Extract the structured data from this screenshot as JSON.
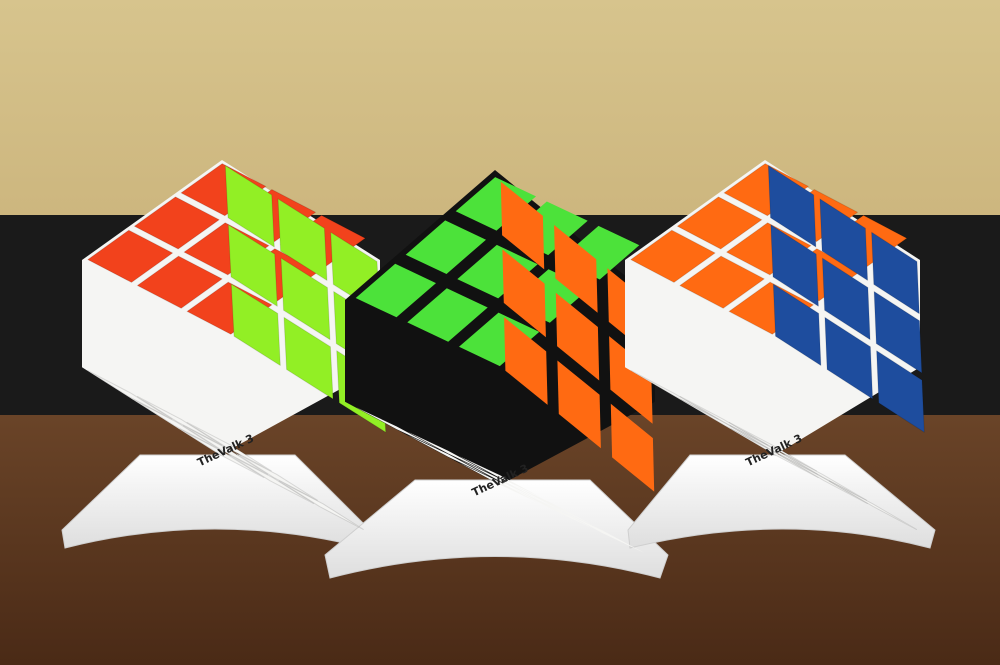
{
  "scene": {
    "background": "#d8c48e",
    "table": "#5e3a22",
    "stand": "#f3f3f1"
  },
  "colors": {
    "red": "#f2421c",
    "orange": "#ff6a12",
    "green": "#4ce23a",
    "lime": "#92ef25",
    "white": "#f5f5f3",
    "blue": "#1e4d9e",
    "black_body": "#111111"
  },
  "cubes": [
    {
      "name": "stickerless",
      "top": "red",
      "left": "lime",
      "right": "white",
      "body": "white"
    },
    {
      "name": "black",
      "top": "green",
      "left": "orange",
      "right": "white",
      "body": "black_body"
    },
    {
      "name": "white",
      "top": "orange",
      "left": "blue",
      "right": "white",
      "body": "white"
    }
  ],
  "logo_text": "TheValk 3"
}
